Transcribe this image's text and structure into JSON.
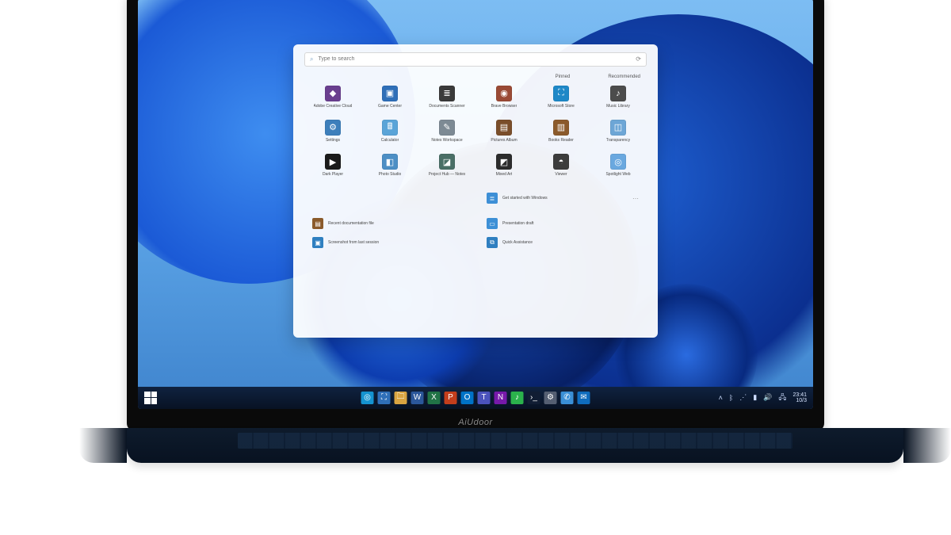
{
  "device": {
    "brand": "AiUdoor"
  },
  "startmenu": {
    "search_placeholder": "Type to search",
    "sections": {
      "pinned": "Pinned",
      "recommended": "Recommended"
    },
    "apps": [
      {
        "label": "Adobe Creative Cloud",
        "bg": "#6a3f8f",
        "glyph": "◆"
      },
      {
        "label": "Game Center",
        "bg": "#2f6fb8",
        "glyph": "▣"
      },
      {
        "label": "Documents Scanner",
        "bg": "#3a3a3a",
        "glyph": "≣"
      },
      {
        "label": "Brave Browser",
        "bg": "#9a4a35",
        "glyph": "◉"
      },
      {
        "label": "Microsoft Store",
        "bg": "#1e88c7",
        "glyph": "⛶"
      },
      {
        "label": "Music Library",
        "bg": "#4c4c4c",
        "glyph": "♪"
      },
      {
        "label": "Settings",
        "bg": "#3d7fbb",
        "glyph": "⚙"
      },
      {
        "label": "Calculator",
        "bg": "#5aa4d8",
        "glyph": "🖩"
      },
      {
        "label": "Notes Workspace",
        "bg": "#7d8a94",
        "glyph": "✎"
      },
      {
        "label": "Pictures Album",
        "bg": "#7a4e2b",
        "glyph": "▤"
      },
      {
        "label": "Books Reader",
        "bg": "#8b5a2b",
        "glyph": "▥"
      },
      {
        "label": "Transparency",
        "bg": "#6da6d6",
        "glyph": "◫"
      },
      {
        "label": "Dark Player",
        "bg": "#1b1b1b",
        "glyph": "▶"
      },
      {
        "label": "Photo Studio",
        "bg": "#4d8fc5",
        "glyph": "◧"
      },
      {
        "label": "Project Hub — Notes",
        "bg": "#4a6f66",
        "glyph": "◪"
      },
      {
        "label": "Mixed Art",
        "bg": "#2c2c2c",
        "glyph": "◩"
      },
      {
        "label": "Viewer",
        "bg": "#3c3c3c",
        "glyph": "◓"
      },
      {
        "label": "Spotlight Web",
        "bg": "#6aa8df",
        "glyph": "◎"
      }
    ],
    "rec_top": {
      "label": "Get started with Windows",
      "bg": "#3d8fd6",
      "glyph": "≣"
    },
    "recs": [
      {
        "label": "Recent documentation file",
        "bg": "#8a5a2b",
        "glyph": "▤"
      },
      {
        "label": "Presentation draft",
        "bg": "#3d8fd6",
        "glyph": "▭"
      },
      {
        "label": "Screenshot from last session",
        "bg": "#2f7fc0",
        "glyph": "▣"
      },
      {
        "label": "Quick Assistance",
        "bg": "#2f7fc0",
        "glyph": "⧉"
      }
    ]
  },
  "taskbar": {
    "center": [
      {
        "name": "edge-icon",
        "bg": "#1593d0",
        "glyph": "◎"
      },
      {
        "name": "store-icon",
        "bg": "#2f6fb8",
        "glyph": "⛶"
      },
      {
        "name": "explorer-icon",
        "bg": "#d9a441",
        "glyph": "🗀"
      },
      {
        "name": "word-icon",
        "bg": "#2b579a",
        "glyph": "W"
      },
      {
        "name": "excel-icon",
        "bg": "#217346",
        "glyph": "X"
      },
      {
        "name": "ppt-icon",
        "bg": "#c43e1c",
        "glyph": "P"
      },
      {
        "name": "outlook-icon",
        "bg": "#0072c6",
        "glyph": "O"
      },
      {
        "name": "teams-icon",
        "bg": "#4b53bc",
        "glyph": "T"
      },
      {
        "name": "onenote-icon",
        "bg": "#7719aa",
        "glyph": "N"
      },
      {
        "name": "music-icon",
        "bg": "#2bb24c",
        "glyph": "♪"
      },
      {
        "name": "terminal-icon",
        "bg": "#111d33",
        "glyph": "›_"
      },
      {
        "name": "settings-icon",
        "bg": "#555f72",
        "glyph": "⚙"
      },
      {
        "name": "chat-icon",
        "bg": "#3a8fd6",
        "glyph": "✆"
      },
      {
        "name": "mail-icon",
        "bg": "#0f6cbd",
        "glyph": "✉"
      }
    ],
    "time": "23:41",
    "date": "10/3"
  }
}
